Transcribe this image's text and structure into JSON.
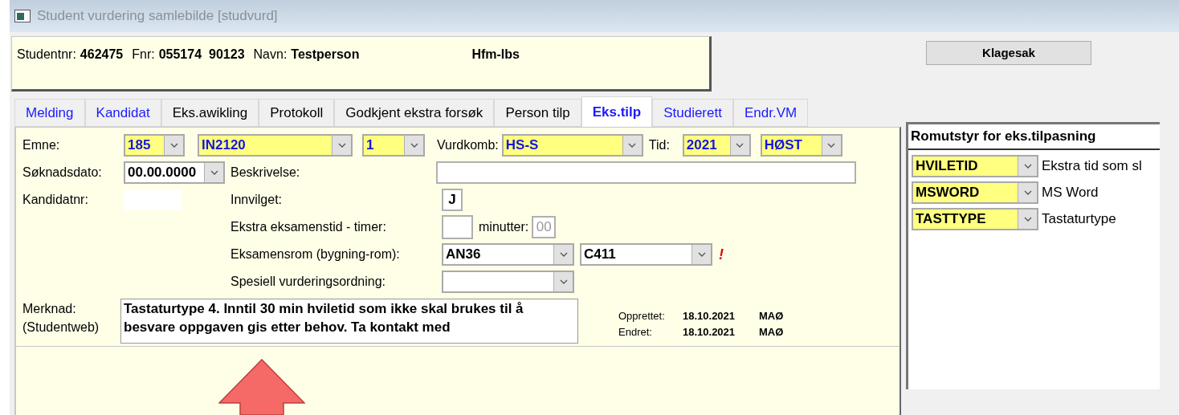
{
  "window": {
    "title": "Student vurdering samlebilde [studvurd]"
  },
  "header": {
    "studentnr_label": "Studentnr:",
    "studentnr": "462475",
    "fnr_label": "Fnr:",
    "fnr_1": "055174",
    "fnr_2": "90123",
    "navn_label": "Navn:",
    "navn": "Testperson",
    "unit": "Hfm-lbs"
  },
  "klagesak_button": "Klagesak",
  "tabs": [
    {
      "label": "Melding",
      "selected": false,
      "color": "#1a1aff"
    },
    {
      "label": "Kandidat",
      "selected": false,
      "color": "#1a1aff"
    },
    {
      "label": "Eks.awikling",
      "selected": false,
      "color": "#000000"
    },
    {
      "label": "Protokoll",
      "selected": false,
      "color": "#000000"
    },
    {
      "label": "Godkjent ekstra forsøk",
      "selected": false,
      "color": "#000000"
    },
    {
      "label": "Person tilp",
      "selected": false,
      "color": "#000000"
    },
    {
      "label": "Eks.tilp",
      "selected": true,
      "color": "#1a1aff"
    },
    {
      "label": "Studierett",
      "selected": false,
      "color": "#1a1aff"
    },
    {
      "label": "Endr.VM",
      "selected": false,
      "color": "#1a1aff"
    }
  ],
  "form": {
    "emne": {
      "label": "Emne:",
      "selects": [
        {
          "value": "185",
          "highlighted": true
        },
        {
          "value": "IN2120",
          "highlighted": true
        },
        {
          "value": "1",
          "highlighted": true
        }
      ]
    },
    "vurdkomb": {
      "label": "Vurdkomb:",
      "value": "HS-S",
      "highlighted": true
    },
    "tid": {
      "label": "Tid:",
      "selects": [
        {
          "value": "2021",
          "highlighted": true
        },
        {
          "value": "HØST",
          "highlighted": true
        }
      ]
    },
    "soknadsdato": {
      "label": "Søknadsdato:",
      "value": "00.00.0000",
      "highlighted": false
    },
    "beskrivelse": {
      "label": "Beskrivelse:"
    },
    "kandidatnr": {
      "label": "Kandidatnr:"
    },
    "innvilget": {
      "label": "Innvilget:",
      "value": "J"
    },
    "ekstra_tid": {
      "label": "Ekstra eksamenstid - timer:",
      "minutter_label": "minutter:",
      "minutter": "00"
    },
    "eksamensrom": {
      "label": "Eksamensrom (bygning-rom):",
      "selects": [
        {
          "value": "AN36",
          "highlighted": false
        },
        {
          "value": "C411",
          "highlighted": false
        }
      ],
      "warning": "!"
    },
    "spesiell": {
      "label": "Spesiell vurderingsordning:",
      "highlighted": false
    },
    "merknad": {
      "label_1": "Merknad:",
      "label_2": "(Studentweb)",
      "value": "Tastaturtype 4. Inntil 30 min hviletid som ikke skal brukes til å besvare oppgaven gis etter behov. Ta kontakt med"
    },
    "opprettet": {
      "label": "Opprettet:",
      "date": "18.10.2021",
      "user": "MAØ"
    },
    "endret": {
      "label": "Endret:",
      "date": "18.10.2021",
      "user": "MAØ"
    }
  },
  "romutstyr": {
    "title": "Romutstyr for eks.tilpasning",
    "items": [
      {
        "code": "HVILETID",
        "highlighted": true,
        "description": "Ekstra tid som sl"
      },
      {
        "code": "MSWORD",
        "highlighted": true,
        "description": "MS Word"
      },
      {
        "code": "TASTTYPE",
        "highlighted": true,
        "description": "Tastaturtype"
      }
    ]
  }
}
